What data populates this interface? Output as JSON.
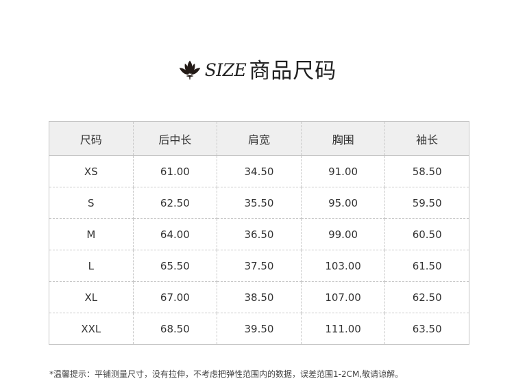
{
  "header": {
    "icon": "lotus-icon",
    "title_en": "SIZE",
    "title_cn": "商品尺码"
  },
  "table": {
    "headers": [
      "尺码",
      "后中长",
      "肩宽",
      "胸围",
      "袖长"
    ],
    "rows": [
      [
        "XS",
        "61.00",
        "34.50",
        "91.00",
        "58.50"
      ],
      [
        "S",
        "62.50",
        "35.50",
        "95.00",
        "59.50"
      ],
      [
        "M",
        "64.00",
        "36.50",
        "99.00",
        "60.50"
      ],
      [
        "L",
        "65.50",
        "37.50",
        "103.00",
        "61.50"
      ],
      [
        "XL",
        "67.00",
        "38.50",
        "107.00",
        "62.50"
      ],
      [
        "XXL",
        "68.50",
        "39.50",
        "111.00",
        "63.50"
      ]
    ]
  },
  "note": "*温馨提示：平铺测量尺寸，没有拉伸，不考虑把弹性范围内的数据，误差范围1-2CM,敬请谅解。",
  "colors": {
    "header_bg": "#efefef",
    "border": "#c4c4c4",
    "text": "#333333",
    "title": "#1f1f1f"
  }
}
